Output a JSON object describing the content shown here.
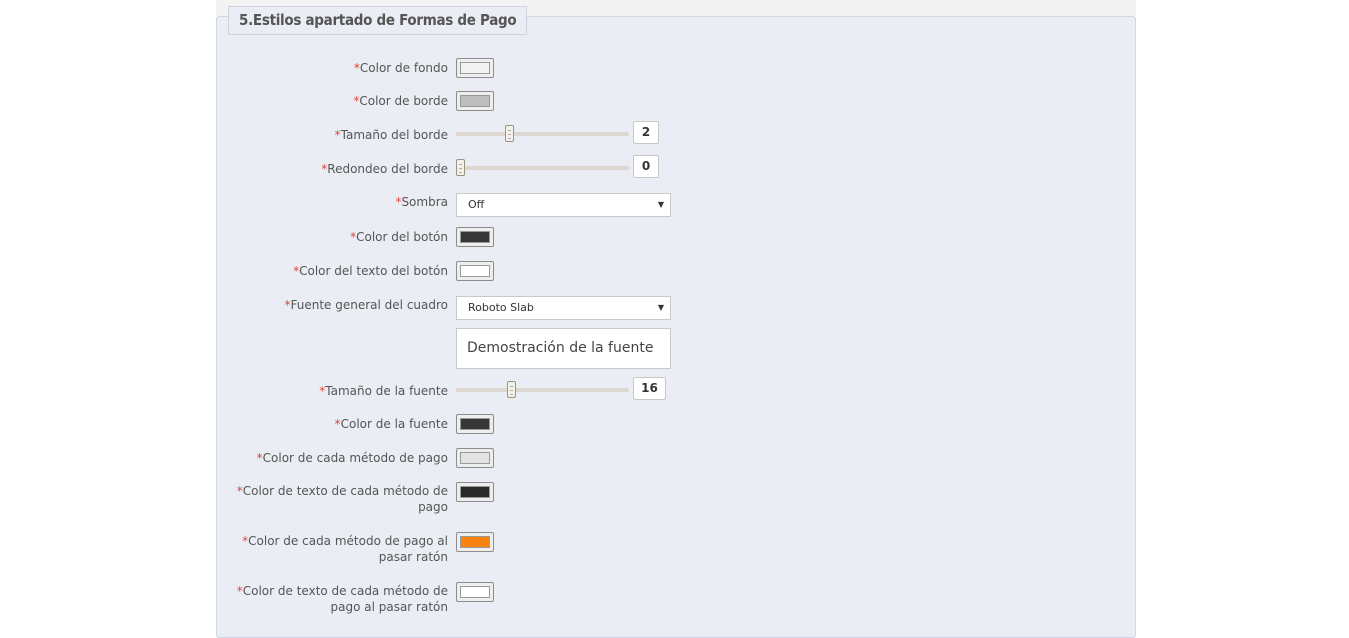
{
  "section": {
    "title": "5.Estilos apartado de Formas de Pago"
  },
  "required_mark": "*",
  "fields": {
    "color_fondo": {
      "label": "Color de fondo",
      "color": "#f2f2f2"
    },
    "color_borde": {
      "label": "Color de borde",
      "color": "#bdbdbd"
    },
    "tamano_borde": {
      "label": "Tamaño del borde",
      "value": "2",
      "level": 0.3
    },
    "redondeo_borde": {
      "label": "Redondeo del borde",
      "value": "0",
      "level": 0.0
    },
    "sombra": {
      "label": "Sombra",
      "selected": "Off"
    },
    "color_boton": {
      "label": "Color del botón",
      "color": "#363636"
    },
    "color_texto_boton": {
      "label": "Color del texto del botón",
      "color": "#ffffff"
    },
    "fuente_general": {
      "label": "Fuente general del cuadro",
      "selected": "Roboto Slab"
    },
    "demo_fuente": {
      "text": "Demostración de la fuente"
    },
    "tamano_fuente": {
      "label": "Tamaño de la fuente",
      "value": "16",
      "level": 0.31
    },
    "color_fuente": {
      "label": "Color de la fuente",
      "color": "#363636"
    },
    "color_metodo": {
      "label": "Color de cada método de pago",
      "color": "#e3e3e3"
    },
    "color_texto_metodo": {
      "label_line1": "Color de texto de cada método de",
      "label_line2": "pago",
      "color": "#2a2a2a"
    },
    "color_metodo_hover": {
      "label_line1": "Color de cada método de pago al",
      "label_line2": "pasar ratón",
      "color": "#f98310"
    },
    "color_texto_metodo_hover": {
      "label_line1": "Color de texto de cada método de",
      "label_line2": "pago al pasar ratón",
      "color": "#ffffff"
    }
  }
}
